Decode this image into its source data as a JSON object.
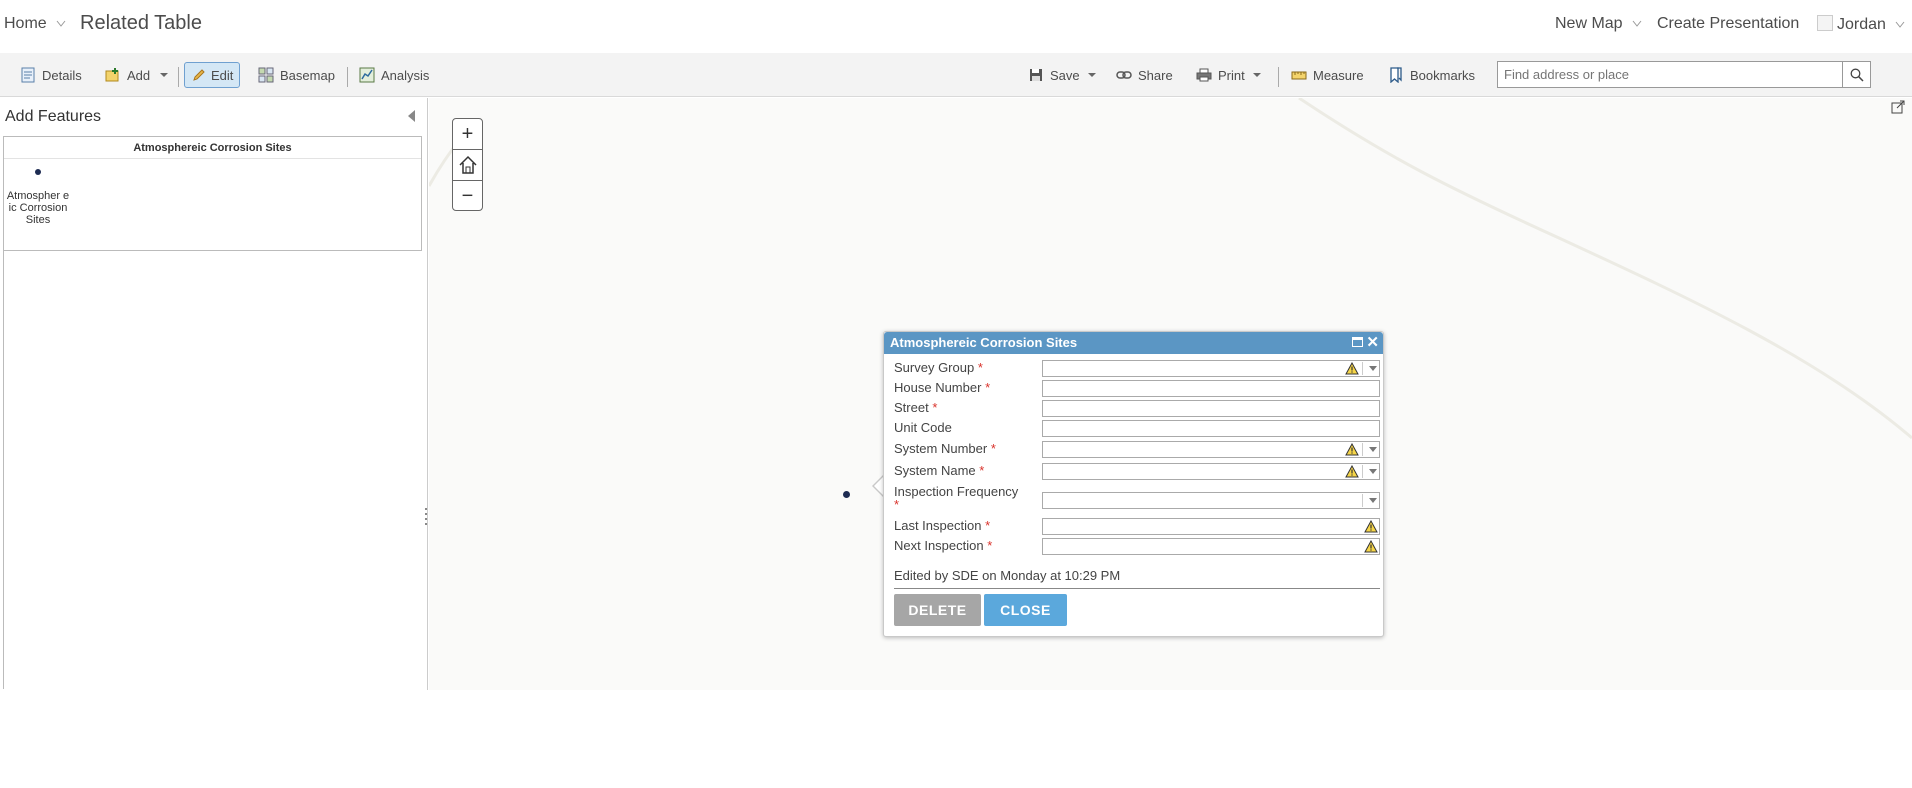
{
  "header": {
    "home_label": "Home",
    "title": "Related Table",
    "new_map_label": "New Map",
    "create_presentation_label": "Create Presentation",
    "user_label": "Jordan"
  },
  "toolbar": {
    "details_label": "Details",
    "add_label": "Add",
    "edit_label": "Edit",
    "basemap_label": "Basemap",
    "analysis_label": "Analysis",
    "save_label": "Save",
    "share_label": "Share",
    "print_label": "Print",
    "measure_label": "Measure",
    "bookmarks_label": "Bookmarks",
    "search_placeholder": "Find address or place"
  },
  "left_panel": {
    "title": "Add Features",
    "template_layer": "Atmosphereic Corrosion Sites",
    "template_item_label": "Atmospher eic Corrosion Sites"
  },
  "map_controls": {
    "zoom_in": "+",
    "zoom_out": "−"
  },
  "popup": {
    "title": "Atmosphereic Corrosion Sites",
    "fields": [
      {
        "label": "Survey Group",
        "required": "*"
      },
      {
        "label": "House Number",
        "required": "*"
      },
      {
        "label": "Street",
        "required": "*"
      },
      {
        "label": "Unit Code",
        "required": ""
      },
      {
        "label": "System Number",
        "required": "*"
      },
      {
        "label": "System Name",
        "required": "*"
      },
      {
        "label": "Inspection Frequency",
        "required": "*"
      },
      {
        "label": "Last Inspection",
        "required": "*"
      },
      {
        "label": "Next Inspection",
        "required": "*"
      }
    ],
    "edited_text": "Edited by SDE on Monday at 10:29 PM",
    "delete_label": "DELETE",
    "close_label": "CLOSE"
  },
  "colors": {
    "popup_header": "#5b96c4",
    "close_button": "#5ba8dc",
    "delete_button": "#a6a6a6",
    "required_marker": "#d9322b",
    "point_symbol": "#1d2b52"
  }
}
